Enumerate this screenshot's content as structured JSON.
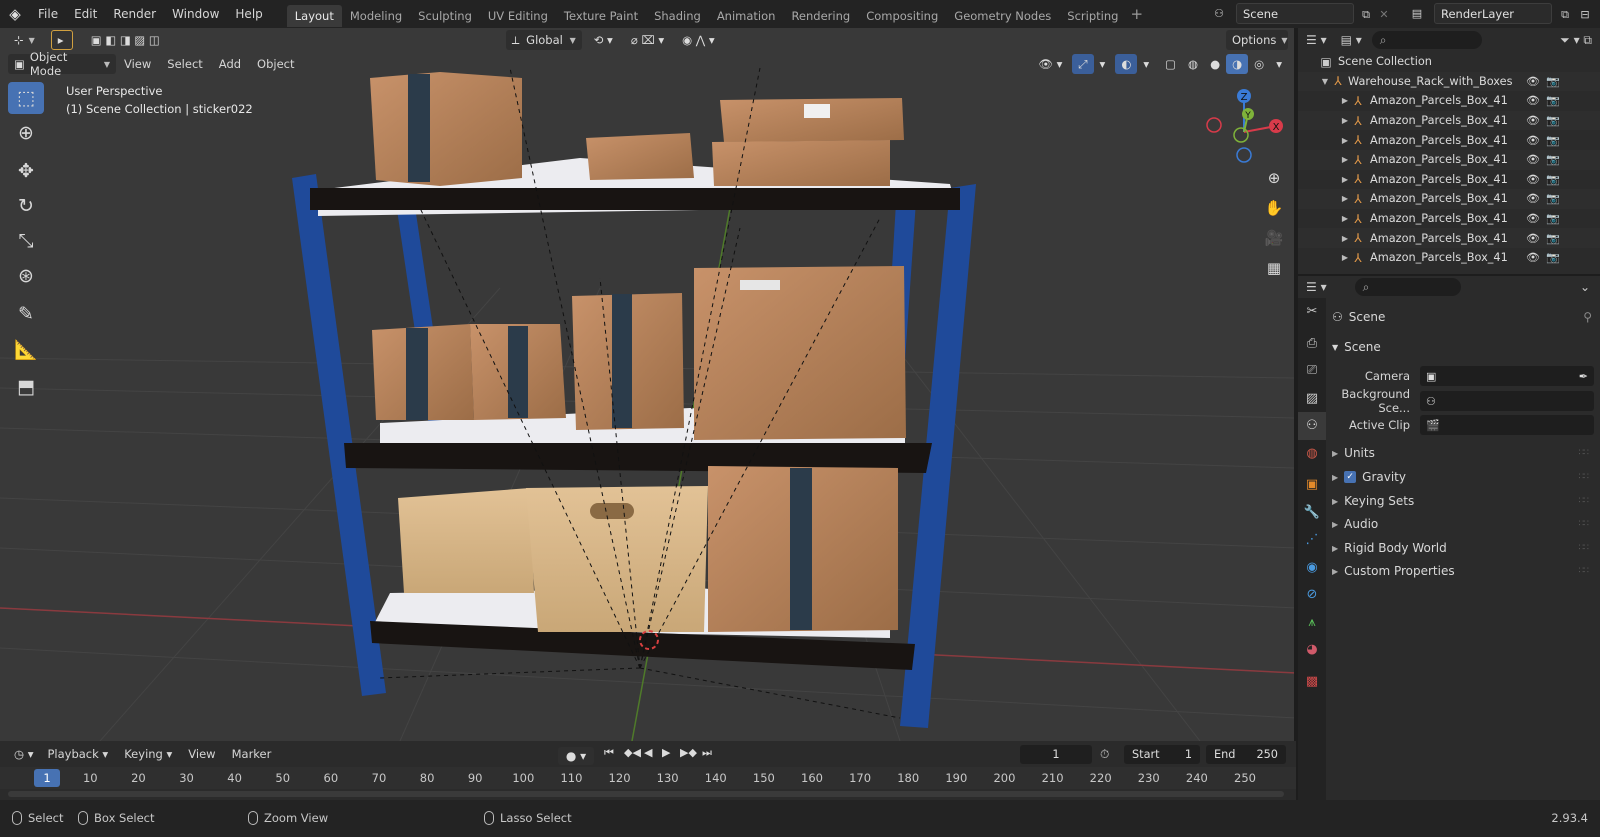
{
  "menu": {
    "items": [
      "File",
      "Edit",
      "Render",
      "Window",
      "Help"
    ]
  },
  "workspaces": [
    "Layout",
    "Modeling",
    "Sculpting",
    "UV Editing",
    "Texture Paint",
    "Shading",
    "Animation",
    "Rendering",
    "Compositing",
    "Geometry Nodes",
    "Scripting"
  ],
  "active_workspace": "Layout",
  "scene_name": "Scene",
  "view_layer": "RenderLayer",
  "viewport": {
    "orientation": "Global",
    "options_label": "Options",
    "mode": "Object Mode",
    "menus": [
      "View",
      "Select",
      "Add",
      "Object"
    ],
    "perspective": "User Perspective",
    "context": "(1) Scene Collection | sticker022",
    "gizmo": {
      "x": "X",
      "y": "Y",
      "z": "Z"
    }
  },
  "outliner": {
    "root": "Scene Collection",
    "collection": "Warehouse_Rack_with_Boxes",
    "items": [
      "Amazon_Parcels_Box_41",
      "Amazon_Parcels_Box_41",
      "Amazon_Parcels_Box_41",
      "Amazon_Parcels_Box_41",
      "Amazon_Parcels_Box_41",
      "Amazon_Parcels_Box_41",
      "Amazon_Parcels_Box_41",
      "Amazon_Parcels_Box_41",
      "Amazon_Parcels_Box_41"
    ]
  },
  "properties": {
    "breadcrumb": "Scene",
    "panel": "Scene",
    "camera_label": "Camera",
    "bg_scene_label": "Background Sce...",
    "active_clip_label": "Active Clip",
    "subpanels": [
      "Units",
      "Gravity",
      "Keying Sets",
      "Audio",
      "Rigid Body World",
      "Custom Properties"
    ],
    "gravity_checked": true
  },
  "timeline": {
    "menus": [
      "Playback",
      "Keying",
      "View",
      "Marker"
    ],
    "current_frame": "1",
    "start_label": "Start",
    "start": "1",
    "end_label": "End",
    "end": "250",
    "ruler": [
      "1",
      "10",
      "20",
      "30",
      "40",
      "50",
      "60",
      "70",
      "80",
      "90",
      "100",
      "110",
      "120",
      "130",
      "140",
      "150",
      "160",
      "170",
      "180",
      "190",
      "200",
      "210",
      "220",
      "230",
      "240",
      "250"
    ]
  },
  "status": {
    "select": "Select",
    "box_select": "Box Select",
    "zoom_view": "Zoom View",
    "lasso_select": "Lasso Select",
    "version": "2.93.4"
  },
  "colors": {
    "accent": "#4772b3",
    "rack_blue": "#1f4a9a",
    "box": "#b9845a",
    "axis_x": "#d83b4a",
    "axis_y": "#7fb33a",
    "axis_z": "#3a7bd6"
  }
}
